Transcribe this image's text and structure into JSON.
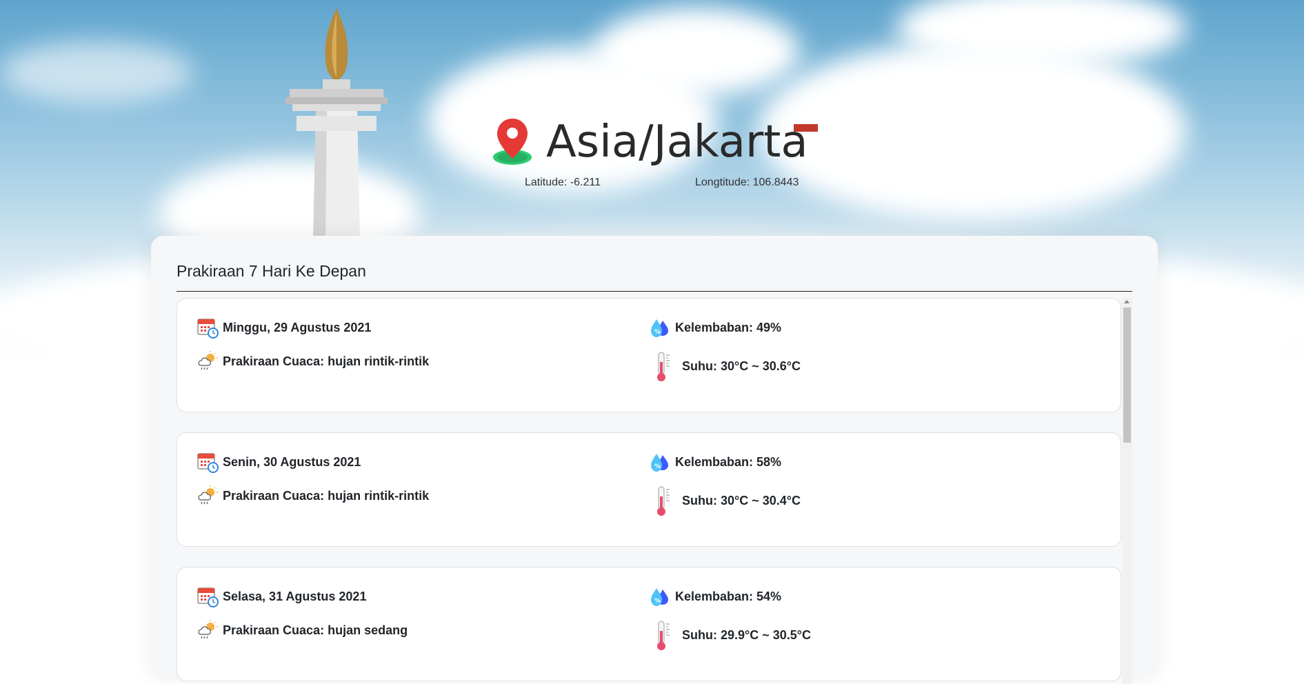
{
  "header": {
    "location_name": "Asia/Jakarta",
    "latitude_text": "Latitude: -6.211",
    "longitude_text": "Longtitude: 106.8443",
    "location_icon": "map-pin-icon"
  },
  "forecast": {
    "title": "Prakiraan 7 Hari Ke Depan",
    "days": [
      {
        "date": "Minggu, 29 Agustus 2021",
        "weather": "Prakiraan Cuaca: hujan rintik-rintik",
        "humidity": "Kelembaban: 49%",
        "temperature": "Suhu: 30°C ~ 30.6°C"
      },
      {
        "date": "Senin, 30 Agustus 2021",
        "weather": "Prakiraan Cuaca: hujan rintik-rintik",
        "humidity": "Kelembaban: 58%",
        "temperature": "Suhu: 30°C ~ 30.4°C"
      },
      {
        "date": "Selasa, 31 Agustus 2021",
        "weather": "Prakiraan Cuaca: hujan sedang",
        "humidity": "Kelembaban: 54%",
        "temperature": "Suhu: 29.9°C ~ 30.5°C"
      }
    ]
  },
  "colors": {
    "flag_red": "#c0392b",
    "panel_bg": "#f6f7f8",
    "card_bg": "#ffffff"
  }
}
